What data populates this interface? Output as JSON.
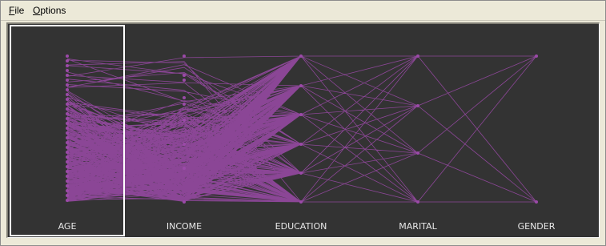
{
  "menu": {
    "file_accel": "F",
    "file_rest": "ile",
    "options_accel": "O",
    "options_rest": "ptions"
  },
  "plot": {
    "line_color": "#9b4aa8",
    "background": "#333333",
    "selection_color": "#ffffff",
    "axes": [
      {
        "id": "age",
        "label": "AGE"
      },
      {
        "id": "income",
        "label": "INCOME"
      },
      {
        "id": "education",
        "label": "EDUCATION"
      },
      {
        "id": "marital",
        "label": "MARITAL"
      },
      {
        "id": "gender",
        "label": "GENDER"
      }
    ],
    "selected_axis": "AGE"
  }
}
